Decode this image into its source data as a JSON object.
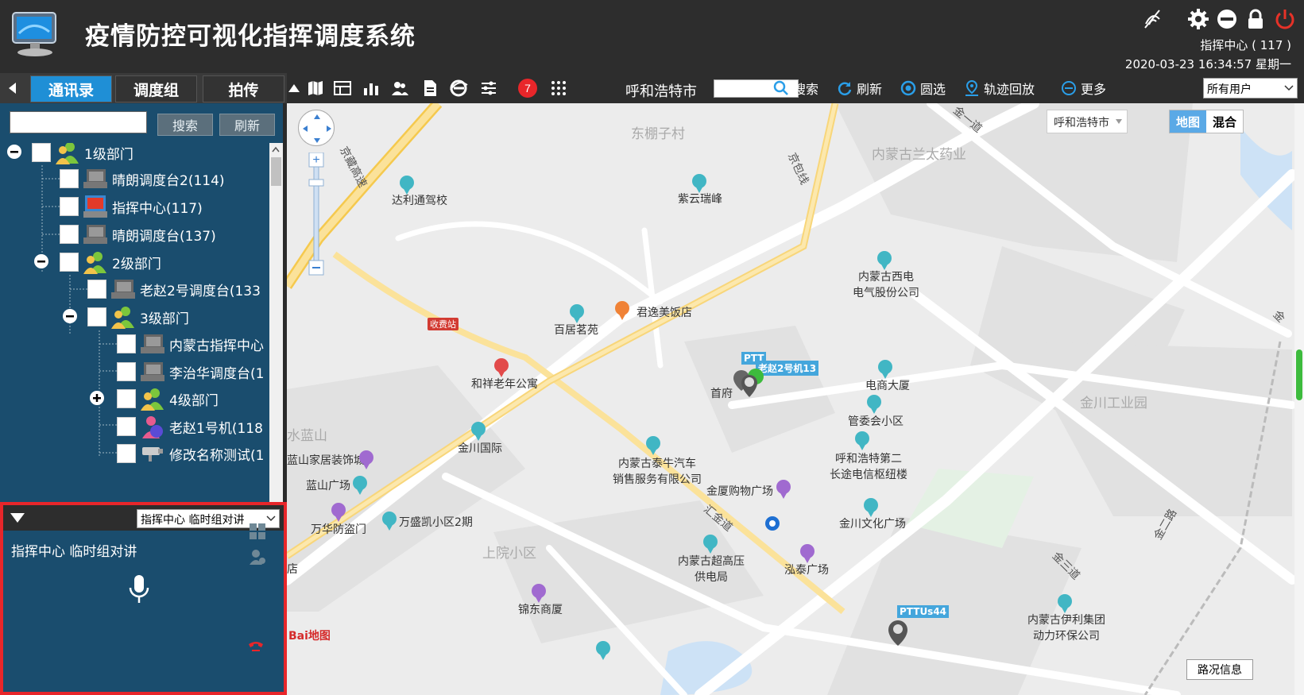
{
  "header": {
    "title": "疫情防控可视化指挥调度系统",
    "user": "指挥中心 ( 117 )",
    "datetime": "2020-03-23 16:34:57 星期一",
    "icons": [
      "no-signal-icon",
      "gear-icon",
      "minimize-icon",
      "lock-icon",
      "power-icon"
    ]
  },
  "left_tabs": [
    "通讯录",
    "调度组",
    "拍传"
  ],
  "toolbar": {
    "city": "呼和浩特市",
    "search_label": "搜索",
    "refresh_label": "刷新",
    "circle_select_label": "圆选",
    "track_playback_label": "轨迹回放",
    "more_label": "更多",
    "user_filter": "所有用户",
    "badge_count": "7"
  },
  "left_panel": {
    "search_label": "搜索",
    "refresh_label": "刷新",
    "tree": [
      {
        "label": "1级部门"
      },
      {
        "label": "晴朗调度台2(114)"
      },
      {
        "label": "指挥中心(117)"
      },
      {
        "label": "晴朗调度台(137)"
      },
      {
        "label": "2级部门"
      },
      {
        "label": "老赵2号调度台(133"
      },
      {
        "label": "3级部门"
      },
      {
        "label": "内蒙古指挥中心"
      },
      {
        "label": "李治华调度台(1"
      },
      {
        "label": "4级部门"
      },
      {
        "label": "老赵1号机(118"
      },
      {
        "label": "修改名称测试(1"
      }
    ]
  },
  "talk": {
    "group_select": "指挥中心 临时组对讲",
    "group_name": "指挥中心 临时组对讲"
  },
  "map": {
    "city_select": "呼和浩特市",
    "type_map": "地图",
    "type_mix": "混合",
    "road_info": "路况信息",
    "baidu_logo": "Bai地图",
    "labels": {
      "dongpengzicun": "东棚子村",
      "neimenggu_lantai": "内蒙古兰太药业",
      "dali_jiaxiao": "达利通驾校",
      "ziyun": "紫云瑞峰",
      "jingzang": "京藏高速",
      "jingbao": "京包线",
      "xidian": "内蒙古西电\n电气股份公司",
      "junyi": "君逸美饭店",
      "baiju": "百居茗苑",
      "shoufeizhan": "收费站",
      "hexiang": "和祥老年公寓",
      "shoufu": "首府",
      "dianshang": "电商大厦",
      "guanweihui": "管委会小区",
      "jinchuan_gy": "金川工业园",
      "jinchuan_gj": "金川国际",
      "huhe_telecom": "呼和浩特第二\n长途电信枢纽楼",
      "tainiu": "内蒙古泰牛汽车\n销售服务有限公司",
      "lanshan_jj": "蓝山家居装饰城",
      "lanshan_gc": "蓝山广场",
      "shuilanshan": "水蓝山",
      "jinsha": "金厦购物广场",
      "wanhua": "万华防盗门",
      "wansheng": "万盛凯小区2期",
      "shangyuan": "上院小区",
      "jinchuan_wh": "金川文化广场",
      "huijin": "汇金道",
      "chaogaoya": "内蒙古超高压\n供电局",
      "hongtai": "泓泰广场",
      "jindong": "锦东商厦",
      "yili": "内蒙古伊利集团\n动力环保公司",
      "jinsandao": "金三道",
      "jinyidao": "金一道",
      "jinerlu": "金二路",
      "jin": "金",
      "dian": "店"
    },
    "vehicles": [
      "老赵2号机13",
      "PTTUs44",
      "PTT"
    ]
  }
}
